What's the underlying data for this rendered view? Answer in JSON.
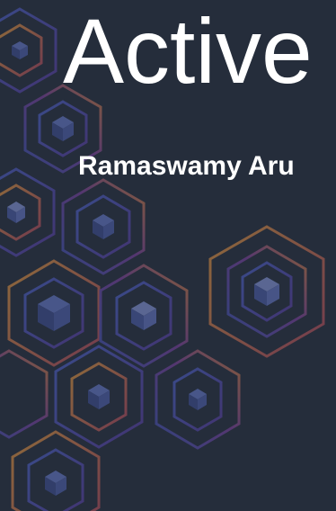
{
  "slide": {
    "title": "Active",
    "author": "Ramaswamy Aru"
  },
  "theme": {
    "background": "#252d3b",
    "text": "#ffffff",
    "accent_blue": "#3a4fa8",
    "accent_purple": "#6b3fa0",
    "accent_orange": "#d7893a",
    "accent_red": "#b84a55"
  },
  "decoration": {
    "icon": "hexagon-cube-pattern"
  }
}
